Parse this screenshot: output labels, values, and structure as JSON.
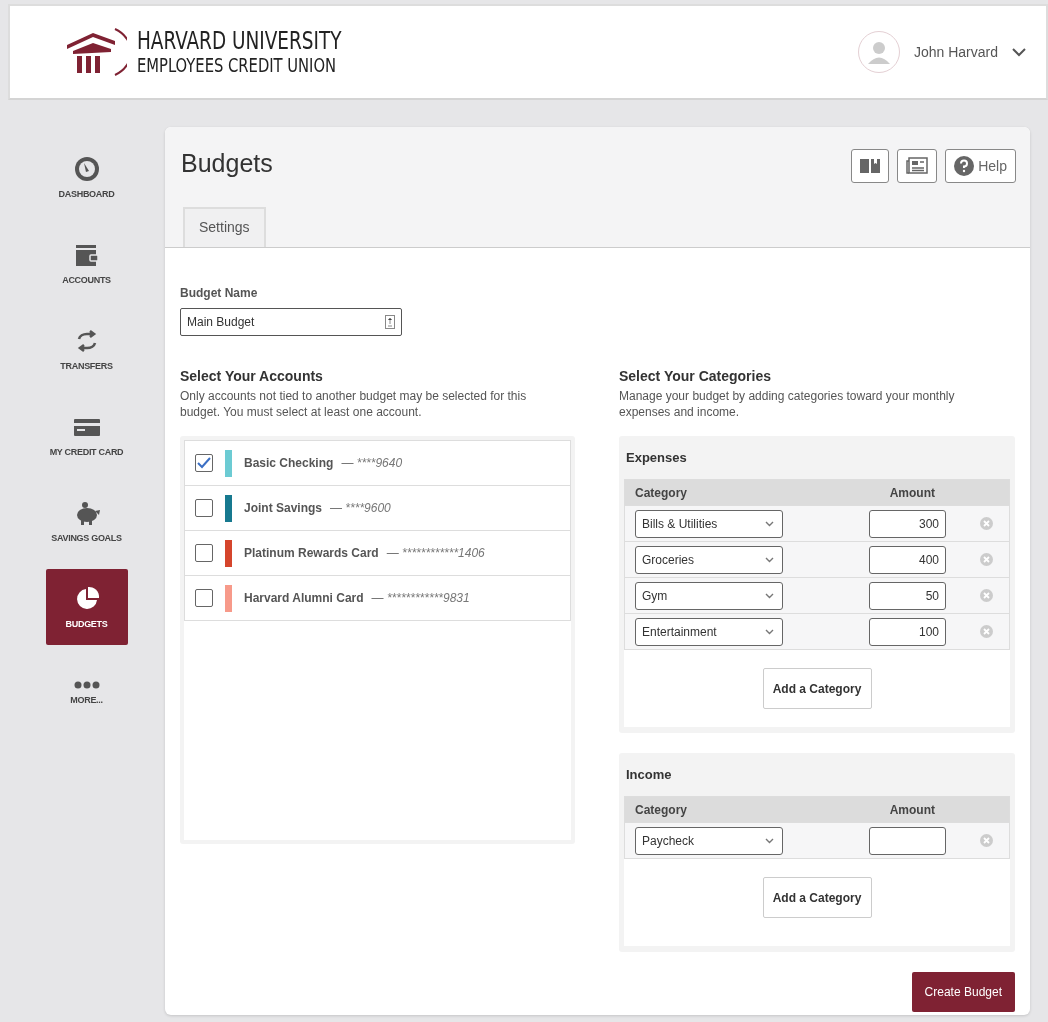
{
  "header": {
    "logo_line1": "HARVARD UNIVERSITY",
    "logo_line2": "EMPLOYEES CREDIT UNION",
    "user_name": "John Harvard"
  },
  "sidebar": {
    "items": [
      {
        "label": "DASHBOARD",
        "selected": false
      },
      {
        "label": "ACCOUNTS",
        "selected": false
      },
      {
        "label": "TRANSFERS",
        "selected": false
      },
      {
        "label": "MY CREDIT CARD",
        "selected": false
      },
      {
        "label": "SAVINGS GOALS",
        "selected": false
      },
      {
        "label": "BUDGETS",
        "selected": true
      },
      {
        "label": "MORE...",
        "selected": false
      }
    ]
  },
  "page": {
    "title": "Budgets",
    "help_label": "Help",
    "tabs": [
      {
        "label": "Settings",
        "selected": true
      }
    ],
    "budget_name": {
      "label": "Budget Name",
      "value": "Main Budget"
    },
    "accounts": {
      "title": "Select Your Accounts",
      "description": "Only accounts not tied to another budget may be selected for this budget. You must select at least one account.",
      "items": [
        {
          "name": "Basic Checking",
          "number": "— ****9640",
          "color": "#6ccbd3",
          "checked": true
        },
        {
          "name": "Joint Savings",
          "number": "— ****9600",
          "color": "#17798f",
          "checked": false
        },
        {
          "name": "Platinum Rewards Card",
          "number": "— ************1406",
          "color": "#d5452c",
          "checked": false
        },
        {
          "name": "Harvard Alumni Card",
          "number": "— ************9831",
          "color": "#f79a8a",
          "checked": false
        }
      ]
    },
    "categories": {
      "title": "Select Your Categories",
      "description": "Manage your budget by adding categories toward your monthly expenses and income.",
      "groups": [
        {
          "title": "Expenses",
          "columns": [
            "Category",
            "Amount"
          ],
          "add_button": "Add a Category",
          "rows": [
            {
              "category": "Bills & Utilities",
              "amount": "300"
            },
            {
              "category": "Groceries",
              "amount": "400"
            },
            {
              "category": "Gym",
              "amount": "50"
            },
            {
              "category": "Entertainment",
              "amount": "100"
            }
          ]
        },
        {
          "title": "Income",
          "columns": [
            "Category",
            "Amount"
          ],
          "add_button": "Add a Category",
          "rows": [
            {
              "category": "Paycheck"
            }
          ]
        }
      ]
    },
    "create_button": "Create Budget"
  }
}
